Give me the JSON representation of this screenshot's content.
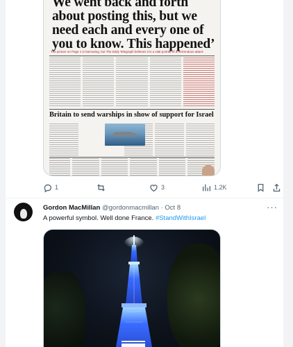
{
  "tweet1": {
    "image": {
      "headline": "We went back and forth about posting this, but we need each and every one of you to know. This happened’",
      "caption": "The picture on Page 1 is harrowing, but The Daily Telegraph believes it is a vital portrait of a horrendous attack",
      "headline2": "Britain to send warships in show of support for Israel"
    },
    "actions": {
      "replies": "1",
      "retweets": "",
      "likes": "3",
      "views": "1.2K"
    }
  },
  "tweet2": {
    "name": "Gordon MacMillan",
    "handle": "@gordonmacmillan",
    "separator": "·",
    "date": "Oct 8",
    "text": "A powerful symbol. Well done France.",
    "hashtag": "#StandWithIsrael",
    "more": "···"
  },
  "colors": {
    "accent": "#1d9bf0",
    "text": "#0f1419",
    "muted": "#536471",
    "tower_blue": "#3a6cff"
  }
}
